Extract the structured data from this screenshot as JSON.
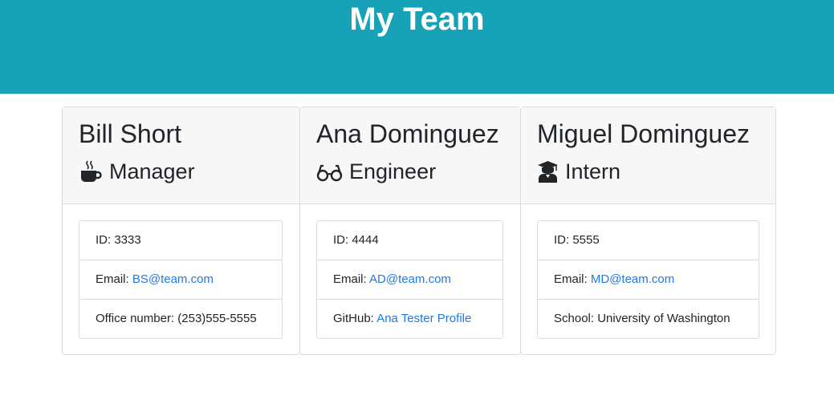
{
  "page": {
    "title": "My Team"
  },
  "colors": {
    "header_bg": "#17a2b8",
    "link": "#1f7ae6"
  },
  "cards": [
    {
      "name": "Bill Short",
      "role": "Manager",
      "icon": "coffee-mug-icon",
      "id_label": "ID: ",
      "id": "3333",
      "email_label": "Email: ",
      "email": "BS@team.com",
      "extra_label": "Office number: ",
      "extra": "(253)555-5555"
    },
    {
      "name": "Ana Dominguez",
      "role": "Engineer",
      "icon": "glasses-icon",
      "id_label": "ID: ",
      "id": "4444",
      "email_label": "Email: ",
      "email": "AD@team.com",
      "extra_label": "GitHub: ",
      "extra": "Ana Tester Profile"
    },
    {
      "name": "Miguel Dominguez",
      "role": "Intern",
      "icon": "graduate-icon",
      "id_label": "ID: ",
      "id": "5555",
      "email_label": "Email: ",
      "email": "MD@team.com",
      "extra_label": "School: ",
      "extra": "University of Washington"
    }
  ]
}
